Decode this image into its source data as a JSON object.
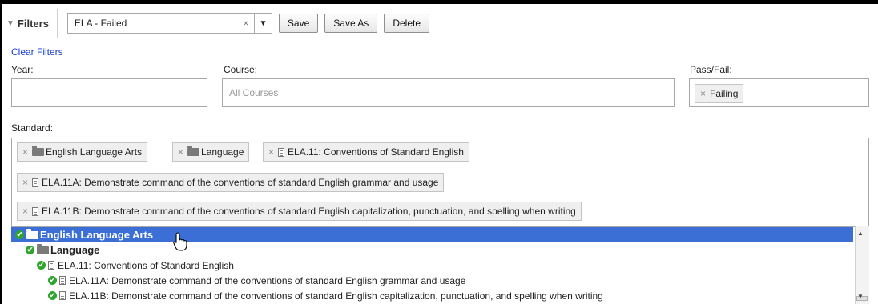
{
  "filters": {
    "title": "Filters",
    "saved_filter_value": "ELA - Failed",
    "save_label": "Save",
    "save_as_label": "Save As",
    "delete_label": "Delete",
    "clear_filters_label": "Clear Filters"
  },
  "fields": {
    "year_label": "Year:",
    "course_label": "Course:",
    "course_placeholder": "All Courses",
    "passfail_label": "Pass/Fail:",
    "passfail_value": "Failing",
    "standard_label": "Standard:"
  },
  "standard_chips": [
    "English Language Arts",
    "Language",
    "ELA.11: Conventions of Standard English",
    "ELA.11A: Demonstrate command of the conventions of standard English grammar and usage",
    "ELA.11B: Demonstrate command of the conventions of standard English capitalization, punctuation, and spelling when writing"
  ],
  "tree": [
    "English Language Arts",
    "Language",
    "ELA.11: Conventions of Standard English",
    "ELA.11A: Demonstrate command of the conventions of standard English grammar and usage",
    "ELA.11B: Demonstrate command of the conventions of standard English capitalization, punctuation, and spelling when writing"
  ],
  "icons": {
    "remove": "×",
    "dropdown": "▼",
    "collapse": "▼",
    "check": "✔",
    "scroll_up": "▲",
    "scroll_down": "▼"
  },
  "colors": {
    "selection": "#3b6fd6",
    "link": "#1a3fcc",
    "check": "#2ea62e"
  }
}
